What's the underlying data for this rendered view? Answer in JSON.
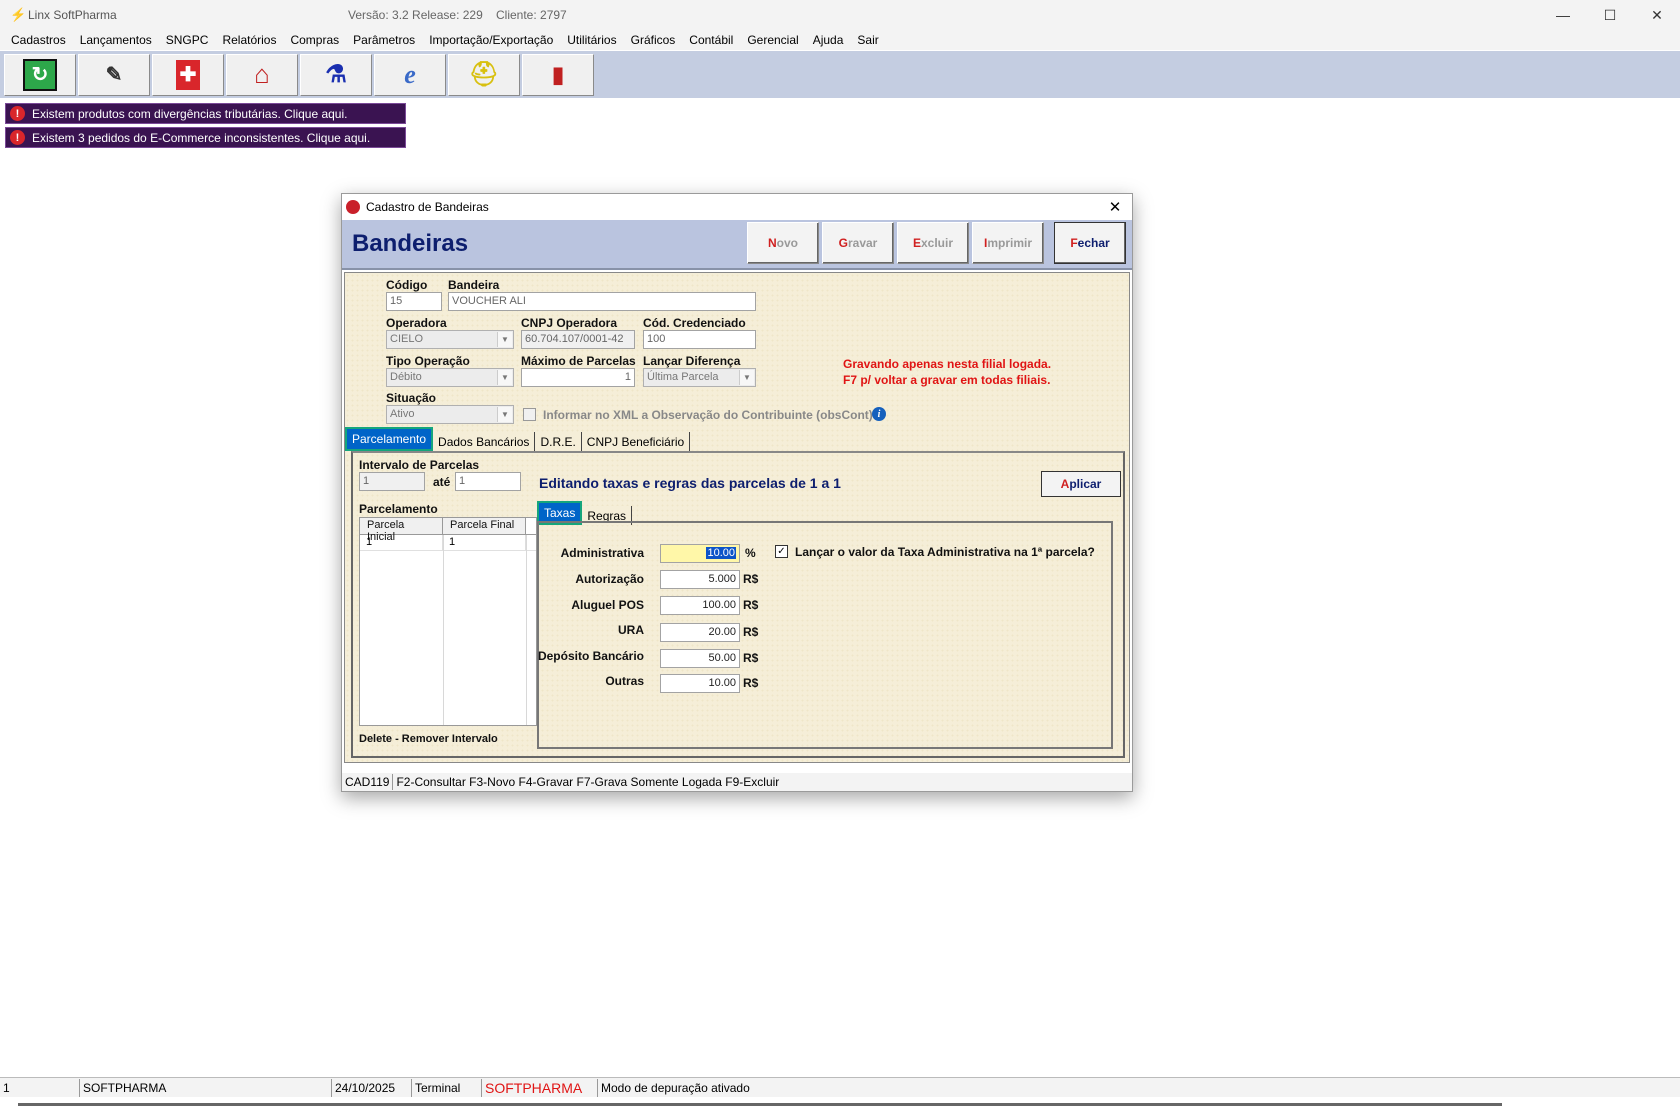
{
  "window": {
    "app_title": "Linx SoftPharma",
    "version": "Versão: 3.2 Release: 229",
    "client": "Cliente: 2797",
    "minimize": "—",
    "maximize": "☐",
    "close": "✕"
  },
  "menu": [
    "Cadastros",
    "Lançamentos",
    "SNGPC",
    "Relatórios",
    "Compras",
    "Parâmetros",
    "Importação/Exportação",
    "Utilitários",
    "Gráficos",
    "Contábil",
    "Gerencial",
    "Ajuda",
    "Sair"
  ],
  "toolbar_icons": [
    "refresh-icon",
    "notepad-icon",
    "pharmacy-cross-icon",
    "house-icon",
    "flask-icon",
    "nfe-icon",
    "helmet-icon",
    "exit-door-icon"
  ],
  "alerts": [
    "Existem produtos com divergências tributárias. Clique aqui.",
    "Existem 3 pedidos do E-Commerce inconsistentes. Clique aqui."
  ],
  "dialog": {
    "title": "Cadastro de Bandeiras",
    "heading": "Bandeiras",
    "buttons": {
      "novo_hk": "N",
      "novo_rest": "ovo",
      "gravar_hk": "G",
      "gravar_rest": "ravar",
      "excluir_hk": "E",
      "excluir_rest": "xcluir",
      "imprimir_hk": "I",
      "imprimir_rest": "mprimir",
      "fechar_hk": "F",
      "fechar_rest": "echar"
    },
    "fields": {
      "codigo_label": "Código",
      "codigo_value": "15",
      "bandeira_label": "Bandeira",
      "bandeira_value": "VOUCHER ALI",
      "operadora_label": "Operadora",
      "operadora_value": "CIELO",
      "cnpj_label": "CNPJ Operadora",
      "cnpj_value": "60.704.107/0001-42",
      "cred_label": "Cód. Credenciado",
      "cred_value": "100",
      "tipo_label": "Tipo Operação",
      "tipo_value": "Débito",
      "max_label": "Máximo de Parcelas",
      "max_value": "1",
      "lancar_label": "Lançar Diferença",
      "lancar_value": "Última Parcela",
      "situacao_label": "Situação",
      "situacao_value": "Ativo",
      "xml_label": "Informar no XML a Observação do Contribuinte (obsCont)"
    },
    "warning": [
      "Gravando apenas nesta filial logada.",
      "F7 p/ voltar a gravar em todas filiais."
    ],
    "tabs": [
      "Parcelamento",
      "Dados Bancários",
      "D.R.E.",
      "CNPJ Beneficiário"
    ],
    "parcelamento": {
      "intervalo_label": "Intervalo de Parcelas",
      "from_value": "1",
      "ate_label": "até",
      "to_value": "1",
      "editing_msg": "Editando taxas e regras das parcelas de 1 a 1",
      "aplicar_hk": "A",
      "aplicar_rest": "plicar",
      "grid_label": "Parcelamento",
      "grid_headers": [
        "Parcela Inicial",
        "Parcela Final"
      ],
      "grid_rows": [
        [
          "1",
          "1"
        ]
      ],
      "delete_hint": "Delete - Remover Intervalo"
    },
    "subtabs": [
      "Taxas",
      "Regras"
    ],
    "taxas": {
      "administrativa_label": "Administrativa",
      "administrativa_value": "10.00",
      "administrativa_unit": "%",
      "autorizacao_label": "Autorização",
      "autorizacao_value": "5.000",
      "autorizacao_unit": "R$",
      "aluguel_label": "Aluguel POS",
      "aluguel_value": "100.00",
      "aluguel_unit": "R$",
      "ura_label": "URA",
      "ura_value": "20.00",
      "ura_unit": "R$",
      "deposito_label": "Depósito Bancário",
      "deposito_value": "50.00",
      "deposito_unit": "R$",
      "outras_label": "Outras",
      "outras_value": "10.00",
      "outras_unit": "R$",
      "lancar_check_label": "Lançar o valor da Taxa Administrativa na 1ª parcela?"
    },
    "status": [
      "CAD119",
      "F2-Consultar  F3-Novo  F4-Gravar  F7-Grava Somente Logada  F9-Excluir"
    ]
  },
  "statusbar": {
    "c1": "1",
    "c2": "SOFTPHARMA",
    "c3": "24/10/2025",
    "c4": "Terminal",
    "c5": "SOFTPHARMA",
    "c6": "Modo de depuração ativado"
  },
  "colors": {
    "toolbar_bg": "#c4cde1",
    "alert_bg": "#3a1351",
    "heading": "#0d1e6e",
    "warning": "#e01414",
    "tab_active": "#0064c8"
  }
}
